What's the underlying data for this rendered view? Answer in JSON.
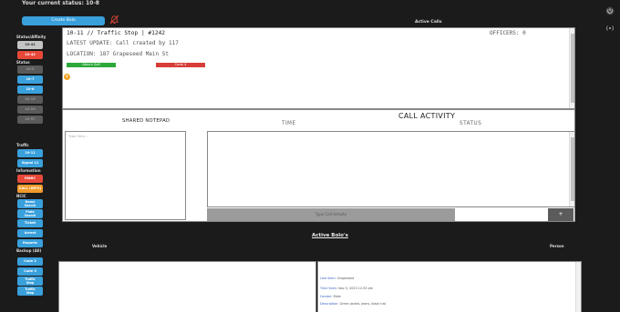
{
  "status": {
    "text": "Your current status: 10-8"
  },
  "toolbar": {
    "create_bolo": "Create Bolo",
    "no_bell_icon": "bell-slash-icon"
  },
  "sidebar": {
    "status_affinity_label": "Status/Affinity",
    "affinity": [
      {
        "label": "10-41",
        "color": "lightgrey"
      },
      {
        "label": "10-42",
        "color": "red"
      }
    ],
    "status_label": "Status",
    "status_buttons": [
      {
        "label": "10-5",
        "color": "grey"
      },
      {
        "label": "10-7",
        "color": "blue"
      },
      {
        "label": "10-6",
        "color": "blue"
      },
      {
        "label": "10-15",
        "color": "grey"
      },
      {
        "label": "10-23",
        "color": "grey"
      },
      {
        "label": "10-97",
        "color": "grey"
      }
    ],
    "traffic_label": "Traffic",
    "traffic": [
      {
        "label": "10-11",
        "color": "blue"
      },
      {
        "label": "Signal 11",
        "color": "blue"
      }
    ],
    "information_label": "Information",
    "information": [
      {
        "label": "PANIC",
        "color": "red"
      },
      {
        "label": "CALL (INFO)",
        "color": "orange"
      }
    ],
    "ncic_label": "NCIC",
    "ncic": [
      {
        "line1": "Name",
        "line2": "Search"
      },
      {
        "line1": "Plate",
        "line2": "Search"
      },
      {
        "line1": "Ticket",
        "line2": ""
      },
      {
        "line1": "Arrest",
        "line2": ""
      },
      {
        "line1": "Reports",
        "line2": ""
      }
    ],
    "backup_label": "Backup (All)",
    "backup": [
      {
        "line1": "Code 2",
        "line2": ""
      },
      {
        "line1": "Code 3",
        "line2": ""
      },
      {
        "line1": "Traffic",
        "line2": "Stop"
      },
      {
        "line1": "Traffic",
        "line2": "Stop"
      }
    ]
  },
  "active_calls": {
    "title": "Active Calls",
    "header": "10-11 // Traffic Stop | #1242",
    "officers": "OFFICERS: 0",
    "latest_update": "LATEST UPDATE: Call created by 117",
    "location": "LOCATION: 187 Grapeseed Main St",
    "attach_self": "Attach Self",
    "code4": "Code 4",
    "add_icon": "plus-circle-icon"
  },
  "notepad": {
    "title": "SHARED NOTEPAD",
    "placeholder": "Type Here..."
  },
  "call_activity": {
    "title": "CALL ACTIVITY",
    "time_header": "TIME",
    "status_header": "STATUS",
    "input_placeholder": "Type Call Activity",
    "add_label": "+"
  },
  "bolos": {
    "title": "Active Bolo's",
    "vehicle_header": "Vehicle",
    "person_header": "Person",
    "entry": {
      "last_seen_label": "Last Seen:",
      "last_seen": "Grapeseed",
      "time_seen_label": "Time Seen:",
      "time_seen": "Nov 3, 2023 12:33 pm",
      "gender_label": "Gender:",
      "gender": "Male",
      "description_label": "Description:",
      "description": "Green jacket, jeans, black hat"
    }
  }
}
